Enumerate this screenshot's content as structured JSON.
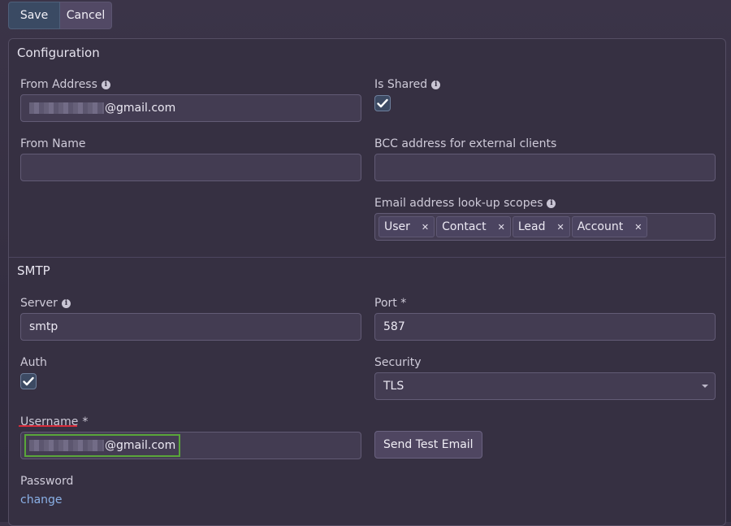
{
  "toolbar": {
    "save_label": "Save",
    "cancel_label": "Cancel"
  },
  "configuration": {
    "title": "Configuration",
    "from_address": {
      "label": "From Address",
      "value_suffix": "@gmail.com"
    },
    "is_shared": {
      "label": "Is Shared",
      "checked": true
    },
    "from_name": {
      "label": "From Name",
      "value": ""
    },
    "bcc": {
      "label": "BCC address for external clients",
      "value": ""
    },
    "lookup_scopes": {
      "label": "Email address look-up scopes",
      "tags": [
        "User",
        "Contact",
        "Lead",
        "Account"
      ]
    }
  },
  "smtp": {
    "title": "SMTP",
    "server": {
      "label": "Server",
      "value": "smtp"
    },
    "port": {
      "label": "Port *",
      "value": "587"
    },
    "auth": {
      "label": "Auth",
      "checked": true
    },
    "security": {
      "label": "Security",
      "value": "TLS"
    },
    "username": {
      "label_main": "Username",
      "label_req": "*",
      "value_suffix": "@gmail.com"
    },
    "send_test_label": "Send Test Email",
    "password": {
      "label": "Password",
      "link": "change"
    }
  }
}
